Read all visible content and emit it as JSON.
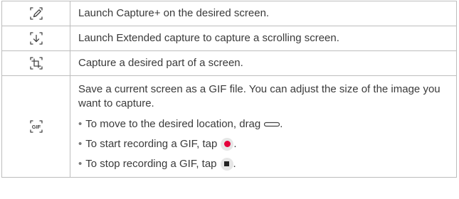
{
  "rows": [
    {
      "icon": "capture-plus-pen-icon",
      "text": "Launch Capture+ on the desired screen."
    },
    {
      "icon": "extended-capture-icon",
      "text": "Launch Extended capture to capture a scrolling screen."
    },
    {
      "icon": "crop-capture-icon",
      "text": "Capture a desired part of a screen."
    },
    {
      "icon": "gif-capture-icon",
      "icon_label": "GIF",
      "text": "Save a current screen as a GIF file. You can adjust the size of the image you want to capture.",
      "bullets": [
        {
          "text": "To move to the desired location, drag",
          "icon": "drag-handle-icon"
        },
        {
          "text": "To start recording a GIF, tap",
          "icon": "record-icon"
        },
        {
          "text": "To stop recording a GIF, tap",
          "icon": "stop-icon"
        }
      ]
    }
  ],
  "colors": {
    "record_dot": "#e5003c",
    "border": "#bdbdbd",
    "text": "#3a3a3a"
  }
}
